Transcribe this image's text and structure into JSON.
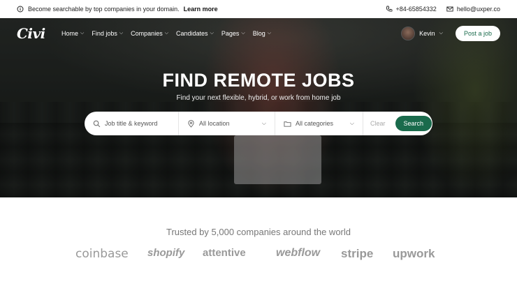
{
  "topbar": {
    "promo_text": "Become searchable by top companies in your domain.",
    "promo_link": "Learn more",
    "phone": "+84-65854332",
    "email": "hello@uxper.co"
  },
  "nav": {
    "logo": "Civi",
    "items": [
      {
        "label": "Home"
      },
      {
        "label": "Find jobs"
      },
      {
        "label": "Companies"
      },
      {
        "label": "Candidates"
      },
      {
        "label": "Pages"
      },
      {
        "label": "Blog"
      }
    ],
    "user_name": "Kevin",
    "post_button": "Post a job"
  },
  "hero": {
    "title": "FIND REMOTE JOBS",
    "subtitle": "Find your next flexible, hybrid, or work from home job"
  },
  "search": {
    "keyword_placeholder": "Job title & keyword",
    "location_value": "All location",
    "category_value": "All categories",
    "clear_label": "Clear",
    "search_label": "Search"
  },
  "trusted": {
    "headline": "Trusted by 5,000 companies around the world",
    "logos": [
      "coinbase",
      "shopify",
      "attentive",
      "webflow",
      "stripe",
      "upwork"
    ]
  },
  "colors": {
    "brand_green": "#1a6b4c"
  }
}
